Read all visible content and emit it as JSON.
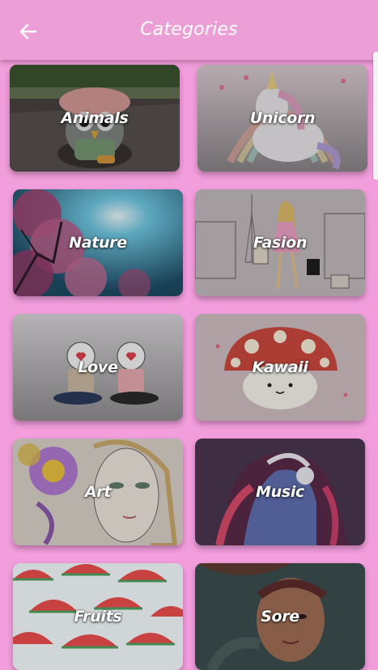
{
  "appbar": {
    "title": "Categories",
    "back_icon": "arrow-left-icon"
  },
  "colors": {
    "background": "#f29ddc",
    "appbar": "#ec9fd6",
    "label_text": "#ffffff"
  },
  "categories": [
    {
      "label": "Animals"
    },
    {
      "label": "Unicorn"
    },
    {
      "label": "Nature"
    },
    {
      "label": "Fasion"
    },
    {
      "label": "Love"
    },
    {
      "label": "Kawaii"
    },
    {
      "label": "Art"
    },
    {
      "label": "Music"
    },
    {
      "label": "Fruits"
    },
    {
      "label": "Sore"
    }
  ]
}
